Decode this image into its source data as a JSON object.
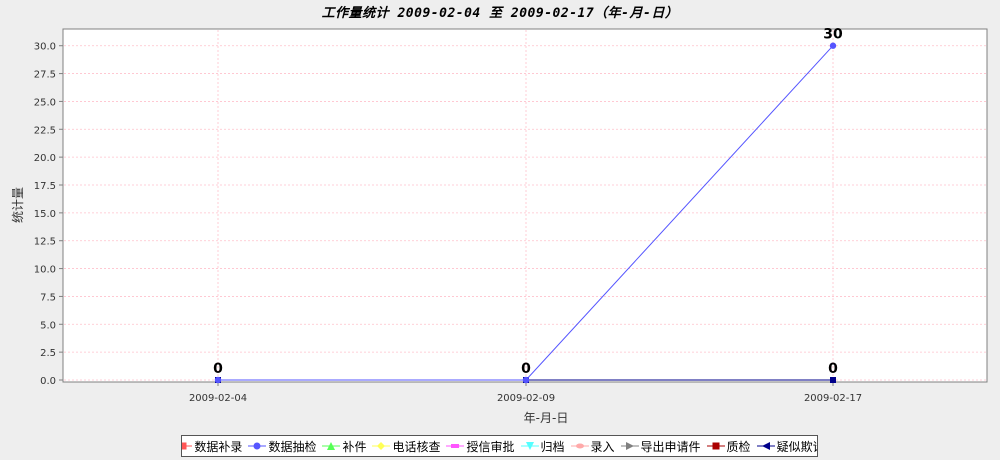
{
  "chart_data": {
    "type": "line",
    "title": "工作量统计 2009-02-04 至 2009-02-17（年-月-日）",
    "xlabel": "年-月-日",
    "ylabel": "统计量",
    "categories": [
      "2009-02-04",
      "2009-02-09",
      "2009-02-17"
    ],
    "ylim": [
      0,
      31.5
    ],
    "yticks": [
      "0.0",
      "2.5",
      "5.0",
      "7.5",
      "10.0",
      "12.5",
      "15.0",
      "17.5",
      "20.0",
      "22.5",
      "25.0",
      "27.5",
      "30.0"
    ],
    "grid": true,
    "legend_position": "bottom",
    "series": [
      {
        "name": "数据补录",
        "values": [
          0,
          0,
          0
        ],
        "color": "#ff5555",
        "marker": "square"
      },
      {
        "name": "数据抽检",
        "values": [
          0,
          0,
          30
        ],
        "color": "#5555ff",
        "marker": "circle"
      },
      {
        "name": "补件",
        "values": [
          0,
          0,
          0
        ],
        "color": "#55ff55",
        "marker": "triangle-up"
      },
      {
        "name": "电话核查",
        "values": [
          0,
          0,
          0
        ],
        "color": "#ffff55",
        "marker": "diamond"
      },
      {
        "name": "授信审批",
        "values": [
          0,
          0,
          0
        ],
        "color": "#ff55ff",
        "marker": "rect"
      },
      {
        "name": "归档",
        "values": [
          0,
          0,
          0
        ],
        "color": "#55ffff",
        "marker": "triangle-down"
      },
      {
        "name": "录入",
        "values": [
          0,
          0,
          0
        ],
        "color": "#ffaaaa",
        "marker": "ellipse"
      },
      {
        "name": "导出申请件",
        "values": [
          0,
          0,
          0
        ],
        "color": "#808080",
        "marker": "triangle-right"
      },
      {
        "name": "质检",
        "values": [
          0,
          0,
          0
        ],
        "color": "#aa0000",
        "marker": "square"
      },
      {
        "name": "疑似欺诈",
        "values": [
          0,
          0,
          0
        ],
        "color": "#00008b",
        "marker": "triangle-left"
      }
    ],
    "data_labels": [
      {
        "category": "2009-02-04",
        "text": "0"
      },
      {
        "category": "2009-02-09",
        "text": "0"
      },
      {
        "category": "2009-02-17",
        "text": "30"
      },
      {
        "category": "2009-02-17",
        "text": "0",
        "zero": true
      }
    ]
  }
}
